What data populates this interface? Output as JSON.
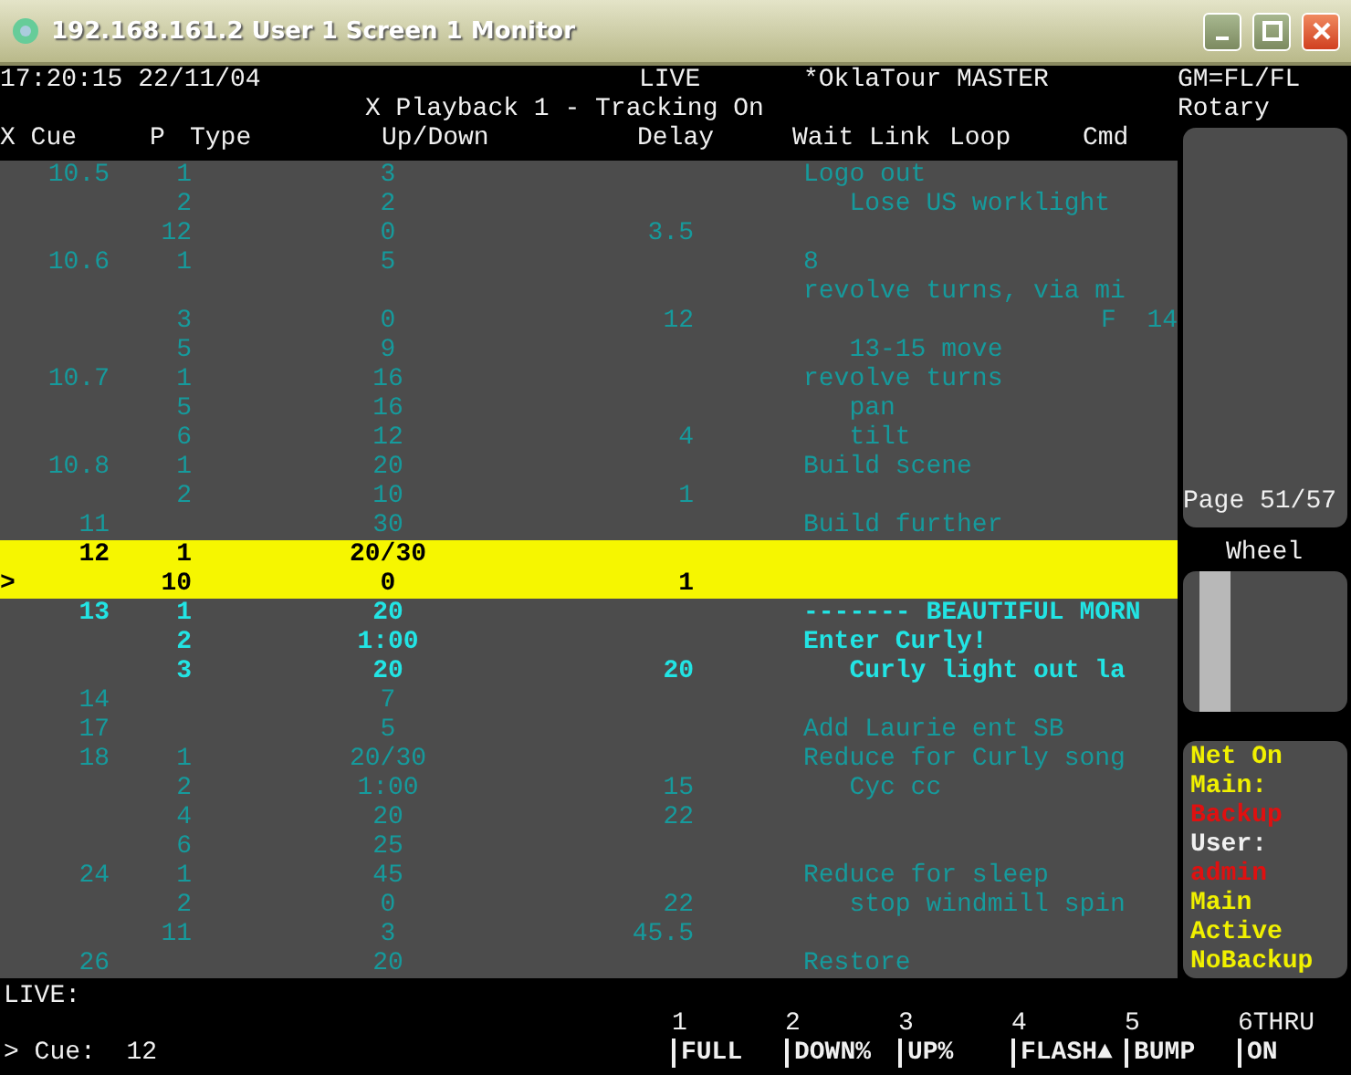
{
  "window": {
    "title": "192.168.161.2 User 1 Screen 1 Monitor"
  },
  "header": {
    "clock": "17:20:15 22/11/04",
    "mode": "LIVE",
    "show": "*OklaTour MASTER",
    "gm": "GM=FL/FL",
    "playback": "X Playback 1 - Tracking On",
    "encoder": "Rotary"
  },
  "table": {
    "columns": [
      "X Cue",
      "P",
      "Type",
      "Up/Down",
      "Delay",
      "Wait",
      "Link",
      "Loop",
      "Cmd"
    ],
    "rows": [
      {
        "kind": "done",
        "cue": "10.5",
        "part": "1",
        "updown": "3",
        "text": "Logo out"
      },
      {
        "kind": "done",
        "part": "2",
        "updown": "2",
        "text": "   Lose US worklight"
      },
      {
        "kind": "done",
        "part": "12",
        "updown": "0",
        "delay": "3.5"
      },
      {
        "kind": "done",
        "cue": "10.6",
        "part": "1",
        "updown": "5",
        "text": "8"
      },
      {
        "kind": "done",
        "text": "revolve turns, via mi"
      },
      {
        "kind": "done",
        "part": "3",
        "updown": "0",
        "delay": "12",
        "cmd": "F  14"
      },
      {
        "kind": "done",
        "part": "5",
        "updown": "9",
        "text": "   13-15 move"
      },
      {
        "kind": "done",
        "cue": "10.7",
        "part": "1",
        "updown": "16",
        "text": "revolve turns"
      },
      {
        "kind": "done",
        "part": "5",
        "updown": "16",
        "text": "   pan"
      },
      {
        "kind": "done",
        "part": "6",
        "updown": "12",
        "delay": "4",
        "text": "   tilt"
      },
      {
        "kind": "done",
        "cue": "10.8",
        "part": "1",
        "updown": "20",
        "text": "Build scene"
      },
      {
        "kind": "done",
        "part": "2",
        "updown": "10",
        "delay": "1"
      },
      {
        "kind": "done",
        "cue": "11",
        "updown": "30",
        "text": "Build further"
      },
      {
        "kind": "active",
        "cue": "12",
        "part": "1",
        "updown": "20/30"
      },
      {
        "kind": "active",
        "marker": ">",
        "part": "10",
        "updown": "0",
        "delay": "1"
      },
      {
        "kind": "pending",
        "cue": "13",
        "part": "1",
        "updown": "20",
        "text": "------- BEAUTIFUL MORN"
      },
      {
        "kind": "pending",
        "part": "2",
        "updown": "1:00",
        "text": "Enter Curly!"
      },
      {
        "kind": "pending",
        "part": "3",
        "updown": "20",
        "delay": "20",
        "text": "   Curly light out la"
      },
      {
        "kind": "done",
        "cue": "14",
        "updown": "7"
      },
      {
        "kind": "done",
        "cue": "17",
        "updown": "5",
        "text": "Add Laurie ent SB"
      },
      {
        "kind": "done",
        "cue": "18",
        "part": "1",
        "updown": "20/30",
        "text": "Reduce for Curly song"
      },
      {
        "kind": "done",
        "part": "2",
        "updown": "1:00",
        "delay": "15",
        "text": "   Cyc cc"
      },
      {
        "kind": "done",
        "part": "4",
        "updown": "20",
        "delay": "22"
      },
      {
        "kind": "done",
        "part": "6",
        "updown": "25"
      },
      {
        "kind": "done",
        "cue": "24",
        "part": "1",
        "updown": "45",
        "text": "Reduce for sleep"
      },
      {
        "kind": "done",
        "part": "2",
        "updown": "0",
        "delay": "22",
        "text": "   stop windmill spin"
      },
      {
        "kind": "done",
        "part": "11",
        "updown": "3",
        "delay": "45.5"
      },
      {
        "kind": "done",
        "cue": "26",
        "updown": "20",
        "text": "Restore"
      }
    ]
  },
  "side": {
    "page": "Page 51/57",
    "wheel_label": "Wheel",
    "status": [
      {
        "text": "Net On",
        "color": "#f0f000"
      },
      {
        "text": "Main:",
        "color": "#f0f000"
      },
      {
        "text": "Backup",
        "color": "#e01010"
      },
      {
        "text": "User:",
        "color": "#f0f0f0"
      },
      {
        "text": "admin",
        "color": "#e01010"
      },
      {
        "text": "Main",
        "color": "#f0f000"
      },
      {
        "text": "Active",
        "color": "#f0f000"
      },
      {
        "text": "NoBackup",
        "color": "#f0f000"
      }
    ]
  },
  "command_line": {
    "mode": "LIVE:",
    "prompt": "> Cue:  12"
  },
  "softkeys": [
    {
      "number": "1",
      "label": "FULL"
    },
    {
      "number": "2",
      "label": "DOWN%"
    },
    {
      "number": "3",
      "label": "UP%"
    },
    {
      "number": "4",
      "label": "FLASH▲"
    },
    {
      "number": "5",
      "label": "BUMP"
    },
    {
      "number": "6THRU",
      "label": "ON"
    }
  ]
}
